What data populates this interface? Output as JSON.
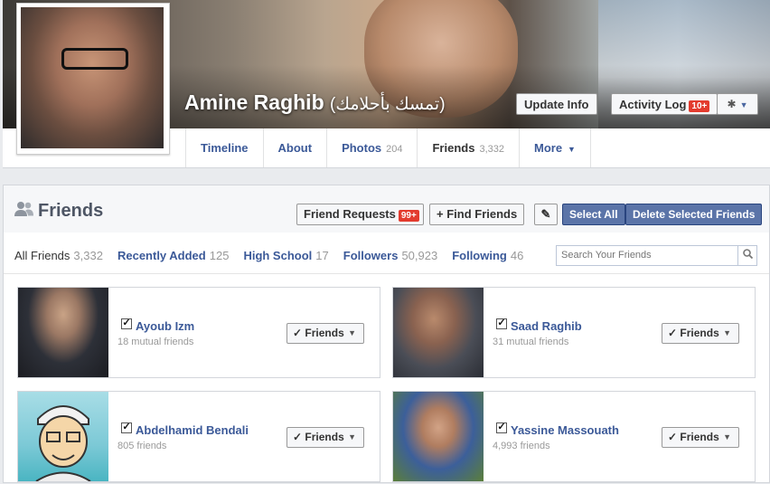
{
  "profile": {
    "name": "Amine Raghib",
    "alt_name": "(تمسك بأحلامك)",
    "update_info_label": "Update Info",
    "activity_log_label": "Activity Log",
    "activity_log_badge": "10+"
  },
  "tabs": [
    {
      "label": "Timeline",
      "count": ""
    },
    {
      "label": "About",
      "count": ""
    },
    {
      "label": "Photos",
      "count": "204"
    },
    {
      "label": "Friends",
      "count": "3,332"
    },
    {
      "label": "More",
      "count": ""
    }
  ],
  "friends_panel": {
    "title": "Friends",
    "friend_requests_label": "Friend Requests",
    "friend_requests_badge": "99+",
    "find_friends_label": "+ Find Friends",
    "select_all_label": "Select All",
    "delete_selected_label": "Delete Selected Friends",
    "search_placeholder": "Search Your Friends",
    "filters": [
      {
        "label": "All Friends",
        "count": "3,332"
      },
      {
        "label": "Recently Added",
        "count": "125"
      },
      {
        "label": "High School",
        "count": "17"
      },
      {
        "label": "Followers",
        "count": "50,923"
      },
      {
        "label": "Following",
        "count": "46"
      }
    ],
    "friends": [
      {
        "name": "Ayoub Izm",
        "sub": "18 mutual friends",
        "button": "Friends"
      },
      {
        "name": "Saad Raghib",
        "sub": "31 mutual friends",
        "button": "Friends"
      },
      {
        "name": "Abdelhamid Bendali",
        "sub": "805 friends",
        "button": "Friends"
      },
      {
        "name": "Yassine Massouath",
        "sub": "4,993 friends",
        "button": "Friends"
      }
    ]
  },
  "colors": {
    "link": "#3b5998",
    "badge": "#e33b2e",
    "blue_button": "#5b74a8"
  },
  "icons": [
    "friends-icon",
    "pencil-icon",
    "gear-icon",
    "search-icon",
    "check-icon",
    "chevron-down-icon"
  ]
}
